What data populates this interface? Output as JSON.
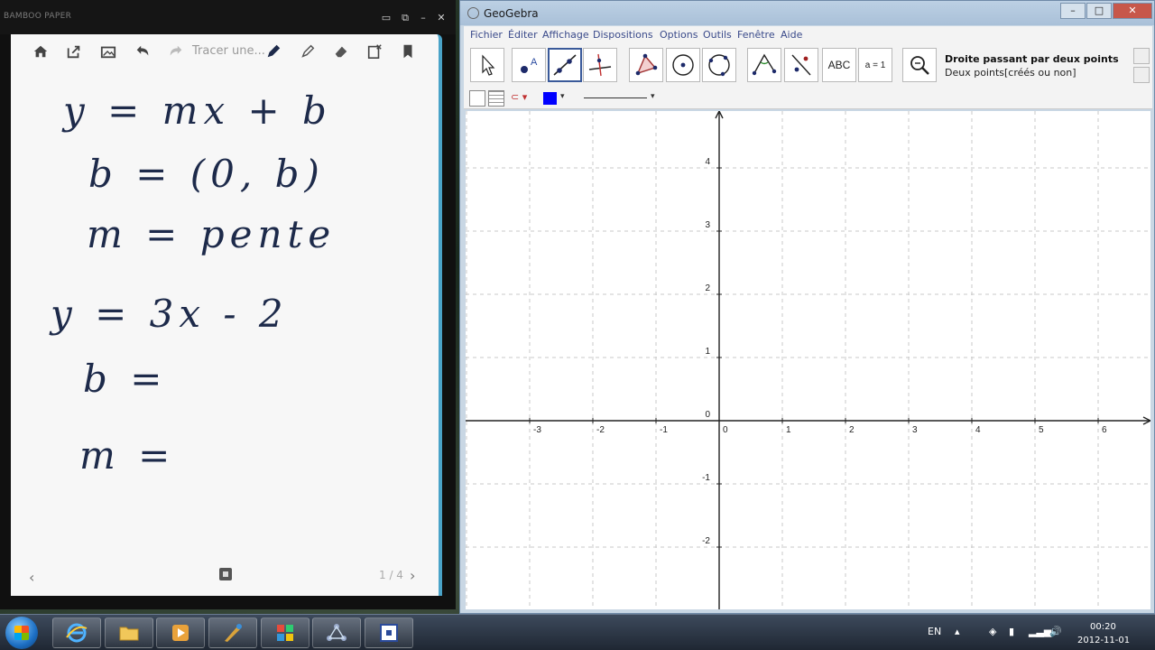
{
  "bamboo": {
    "title": "BAMBOO PAPER",
    "trace_label": "Tracer une...",
    "lines": [
      "y = mx + b",
      "b = (0, b)",
      "m = pente",
      "y = 3x - 2",
      "b =",
      "m ="
    ],
    "page_indicator": "1 / 4"
  },
  "geogebra": {
    "title": "GeoGebra",
    "menus": [
      "Fichier",
      "Éditer",
      "Affichage",
      "Dispositions",
      "Options",
      "Outils",
      "Fenêtre",
      "Aide"
    ],
    "tool_title": "Droite passant par deux points",
    "tool_help": "Deux points[créés ou non]",
    "abc_label": "ABC",
    "slider_label": "a = 1",
    "x_ticks": [
      -3,
      -2,
      -1,
      0,
      1,
      2,
      3,
      4,
      5,
      6
    ],
    "y_ticks": [
      4,
      3,
      2,
      1,
      0,
      -1,
      -2
    ],
    "accent": "#3a5a9a",
    "style_color": "#0000ff"
  },
  "taskbar": {
    "lang": "EN",
    "time": "00:20",
    "date": "2012-11-01"
  }
}
